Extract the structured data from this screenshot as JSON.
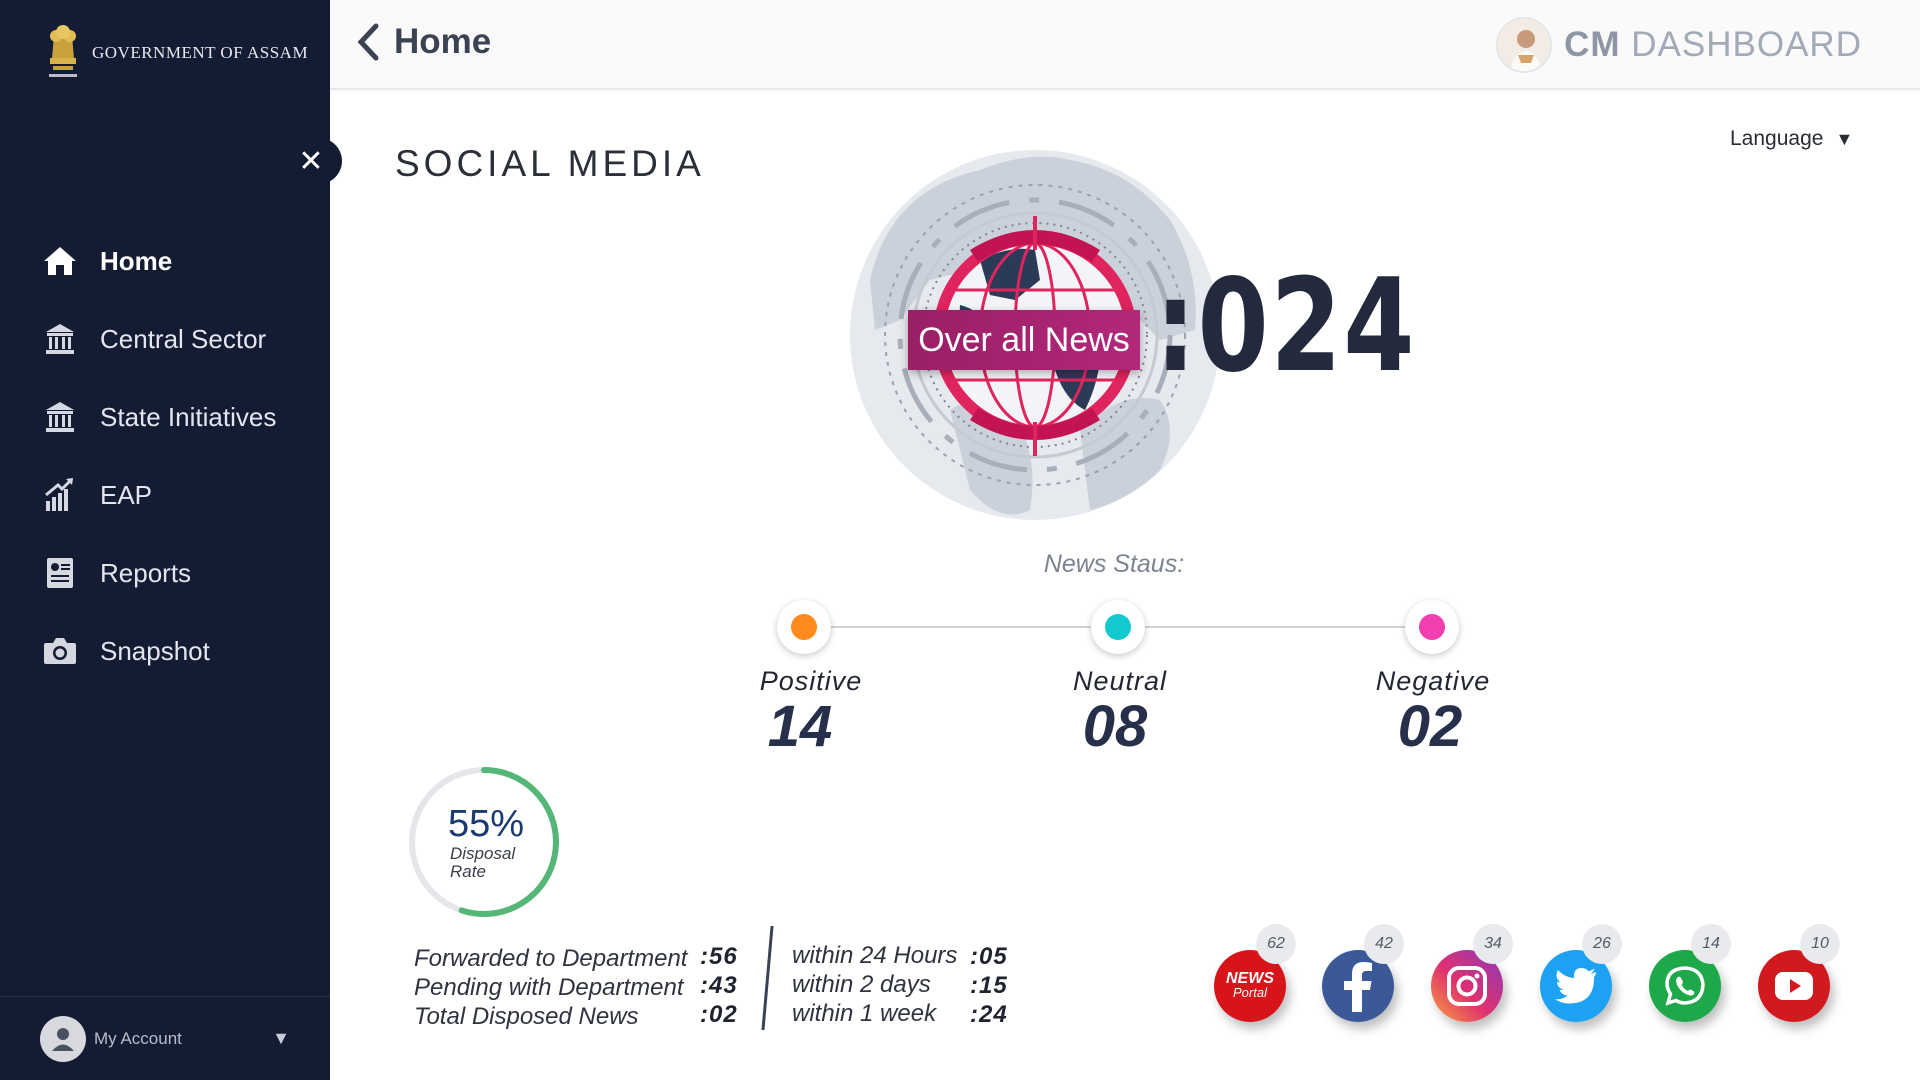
{
  "sidebar": {
    "logo_text": "GOVERNMENT OF ASSAM",
    "close_label": "✕",
    "items": [
      {
        "label": "Home",
        "icon": "home-icon"
      },
      {
        "label": "Central Sector",
        "icon": "bank-icon"
      },
      {
        "label": "State Initiatives",
        "icon": "bank-icon"
      },
      {
        "label": "EAP",
        "icon": "growth-chart-icon"
      },
      {
        "label": "Reports",
        "icon": "report-icon"
      },
      {
        "label": "Snapshot",
        "icon": "camera-icon"
      }
    ],
    "account_label": "My Account"
  },
  "header": {
    "title": "Home",
    "dashboard_bold": "CM",
    "dashboard_label": "DASHBOARD"
  },
  "main": {
    "title": "SOCIAL MEDIA",
    "language_label": "Language",
    "overall_label": "Over all News",
    "overall_count": ":024",
    "status_title": "News Staus:",
    "statuses": [
      {
        "label": "Positive",
        "value": "14",
        "color": "#ff8a1e"
      },
      {
        "label": "Neutral",
        "value": "08",
        "color": "#12c9cf"
      },
      {
        "label": "Negative",
        "value": "02",
        "color": "#f23fb0"
      }
    ],
    "disposal": {
      "percent_label": "55%",
      "percent": 55,
      "line1": "Disposal",
      "line2": "Rate"
    },
    "stats_left": [
      {
        "label": "Forwarded to Department",
        "value": ":56"
      },
      {
        "label": "Pending with Department",
        "value": ":43"
      },
      {
        "label": "Total Disposed News",
        "value": ":02"
      }
    ],
    "stats_right": [
      {
        "label": "within 24 Hours",
        "value": ":05"
      },
      {
        "label": "within 2 days",
        "value": ":15"
      },
      {
        "label": "within 1 week",
        "value": ":24"
      }
    ],
    "channels": [
      {
        "name": "news-portal",
        "count": "62",
        "logo_line1": "NEWS",
        "logo_line2": "Portal",
        "color": "#d7141a"
      },
      {
        "name": "facebook",
        "count": "42",
        "color": "#3b5998"
      },
      {
        "name": "instagram",
        "count": "34",
        "color": "#c13584"
      },
      {
        "name": "twitter",
        "count": "26",
        "color": "#1da1f2"
      },
      {
        "name": "whatsapp",
        "count": "14",
        "color": "#1ea84a"
      },
      {
        "name": "youtube",
        "count": "10",
        "color": "#d31920"
      }
    ]
  }
}
